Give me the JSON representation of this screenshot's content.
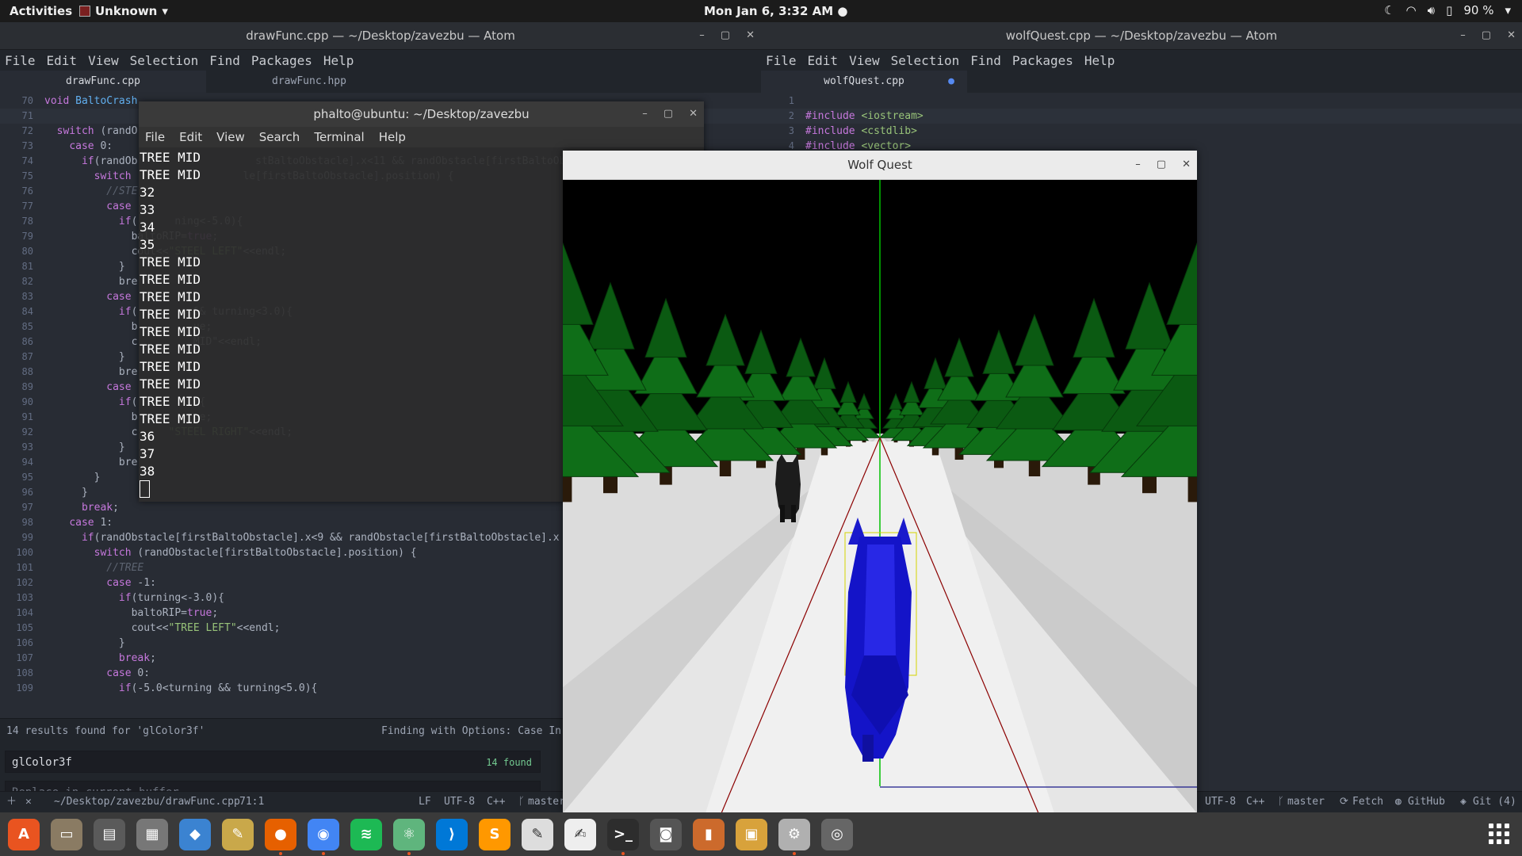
{
  "topbar": {
    "activities": "Activities",
    "app_menu": "Unknown",
    "clock": "Mon Jan 6, 3:32 AM",
    "battery": "90 %"
  },
  "atom_left": {
    "title": "drawFunc.cpp — ~/Desktop/zavezbu — Atom",
    "menu": [
      "File",
      "Edit",
      "View",
      "Selection",
      "Find",
      "Packages",
      "Help"
    ],
    "tabs": [
      "drawFunc.cpp",
      "drawFunc.hpp"
    ],
    "lines": [
      {
        "n": "70",
        "t": "void BaltoCrash"
      },
      {
        "n": "71",
        "t": ""
      },
      {
        "n": "72",
        "t": "  switch (randO"
      },
      {
        "n": "73",
        "t": "    case 0:"
      },
      {
        "n": "74",
        "t": "      if(randOb                   stBaltoObstacle].x<11 && randObstacle[firstBaltoObstacle].x"
      },
      {
        "n": "75",
        "t": "        switch                  le[firstBaltoObstacle].position) {"
      },
      {
        "n": "76",
        "t": "          //STE"
      },
      {
        "n": "77",
        "t": "          case"
      },
      {
        "n": "78",
        "t": "            if(      ning<-5.0){"
      },
      {
        "n": "79",
        "t": "              baltoRIP=true;"
      },
      {
        "n": "80",
        "t": "              cout<<\"STEEL LEFT\"<<endl;"
      },
      {
        "n": "81",
        "t": "            }"
      },
      {
        "n": "82",
        "t": "            bre"
      },
      {
        "n": "83",
        "t": "          case"
      },
      {
        "n": "84",
        "t": "            if(       g && turning<3.0){"
      },
      {
        "n": "85",
        "t": "              b         ue;"
      },
      {
        "n": "86",
        "t": "              c         MID\"<<endl;"
      },
      {
        "n": "87",
        "t": "            }"
      },
      {
        "n": "88",
        "t": "            bre"
      },
      {
        "n": "89",
        "t": "          case"
      },
      {
        "n": "90",
        "t": "            if(         ){"
      },
      {
        "n": "91",
        "t": "              b         ue;"
      },
      {
        "n": "92",
        "t": "              c     \"STEEL RIGHT\"<<endl;"
      },
      {
        "n": "93",
        "t": "            }"
      },
      {
        "n": "94",
        "t": "            bre"
      },
      {
        "n": "95",
        "t": "        }"
      },
      {
        "n": "96",
        "t": "      }"
      },
      {
        "n": "97",
        "t": "      break;"
      },
      {
        "n": "98",
        "t": "    case 1:"
      },
      {
        "n": "99",
        "t": "      if(randObstacle[firstBaltoObstacle].x<9 && randObstacle[firstBaltoObstacle].x"
      },
      {
        "n": "100",
        "t": "        switch (randObstacle[firstBaltoObstacle].position) {"
      },
      {
        "n": "101",
        "t": "          //TREE"
      },
      {
        "n": "102",
        "t": "          case -1:"
      },
      {
        "n": "103",
        "t": "            if(turning<-3.0){"
      },
      {
        "n": "104",
        "t": "              baltoRIP=true;"
      },
      {
        "n": "105",
        "t": "              cout<<\"TREE LEFT\"<<endl;"
      },
      {
        "n": "106",
        "t": "            }"
      },
      {
        "n": "107",
        "t": "            break;"
      },
      {
        "n": "108",
        "t": "          case 0:"
      },
      {
        "n": "109",
        "t": "            if(-5.0<turning && turning<5.0){"
      }
    ],
    "find": {
      "results": "14 results found for 'glColor3f'",
      "options": "Finding with Options: Case In",
      "query": "glColor3f",
      "count": "14 found",
      "replace_placeholder": "Replace in current buffer"
    },
    "status": {
      "path": "~/Desktop/zavezbu/drawFunc.cpp",
      "pos": "71:1",
      "eol": "LF",
      "enc": "UTF-8",
      "lang": "C++",
      "branch": "master"
    }
  },
  "atom_right": {
    "title": "wolfQuest.cpp — ~/Desktop/zavezbu — Atom",
    "menu": [
      "File",
      "Edit",
      "View",
      "Selection",
      "Find",
      "Packages",
      "Help"
    ],
    "tab": "wolfQuest.cpp",
    "lines": [
      {
        "n": "1",
        "t": ""
      },
      {
        "n": "2",
        "t": "#include <iostream>"
      },
      {
        "n": "3",
        "t": "#include <cstdlib>"
      },
      {
        "n": "4",
        "t": "#include <vector>"
      }
    ],
    "status": {
      "enc": "UTF-8",
      "lang": "C++",
      "branch": "master",
      "fetch": "Fetch",
      "github": "GitHub",
      "git": "Git (4)"
    }
  },
  "terminal": {
    "title": "phalto@ubuntu: ~/Desktop/zavezbu",
    "menu": [
      "File",
      "Edit",
      "View",
      "Search",
      "Terminal",
      "Help"
    ],
    "output": [
      "TREE MID",
      "TREE MID",
      "32",
      "33",
      "34",
      "35",
      "TREE MID",
      "TREE MID",
      "TREE MID",
      "TREE MID",
      "TREE MID",
      "TREE MID",
      "TREE MID",
      "TREE MID",
      "TREE MID",
      "TREE MID",
      "36",
      "37",
      "38"
    ]
  },
  "game": {
    "title": "Wolf Quest"
  },
  "dock": {
    "apps": [
      {
        "name": "software-icon",
        "color": "#e95420",
        "glyph": "A"
      },
      {
        "name": "files-icon",
        "color": "#8a7b63",
        "glyph": "▭"
      },
      {
        "name": "drawer-icon",
        "color": "#5a5a5a",
        "glyph": "▤"
      },
      {
        "name": "grid-icon",
        "color": "#777777",
        "glyph": "▦"
      },
      {
        "name": "dropbox-icon",
        "color": "#3b83d1",
        "glyph": "◆"
      },
      {
        "name": "folder-edit-icon",
        "color": "#c9a84a",
        "glyph": "✎"
      },
      {
        "name": "firefox-icon",
        "color": "#e66000",
        "glyph": "●"
      },
      {
        "name": "chrome-icon",
        "color": "#4285f4",
        "glyph": "◉"
      },
      {
        "name": "spotify-icon",
        "color": "#1db954",
        "glyph": "≋"
      },
      {
        "name": "atom-icon",
        "color": "#5fb57d",
        "glyph": "⚛"
      },
      {
        "name": "vscode-icon",
        "color": "#0078d7",
        "glyph": "⟩"
      },
      {
        "name": "sublime-icon",
        "color": "#ff9800",
        "glyph": "S"
      },
      {
        "name": "text-editor-icon",
        "color": "#dddddd",
        "glyph": "✎"
      },
      {
        "name": "notes-icon",
        "color": "#eeeeee",
        "glyph": "✍"
      },
      {
        "name": "terminal-icon",
        "color": "#2d2d2d",
        "glyph": ">_"
      },
      {
        "name": "camera-icon",
        "color": "#555555",
        "glyph": "◙"
      },
      {
        "name": "archive-icon",
        "color": "#cc6a2c",
        "glyph": "▮"
      },
      {
        "name": "screenshot-icon",
        "color": "#d8a23b",
        "glyph": "▣"
      },
      {
        "name": "settings-icon",
        "color": "#b0b0b0",
        "glyph": "⚙"
      },
      {
        "name": "game-icon",
        "color": "#666666",
        "glyph": "◎"
      }
    ]
  }
}
